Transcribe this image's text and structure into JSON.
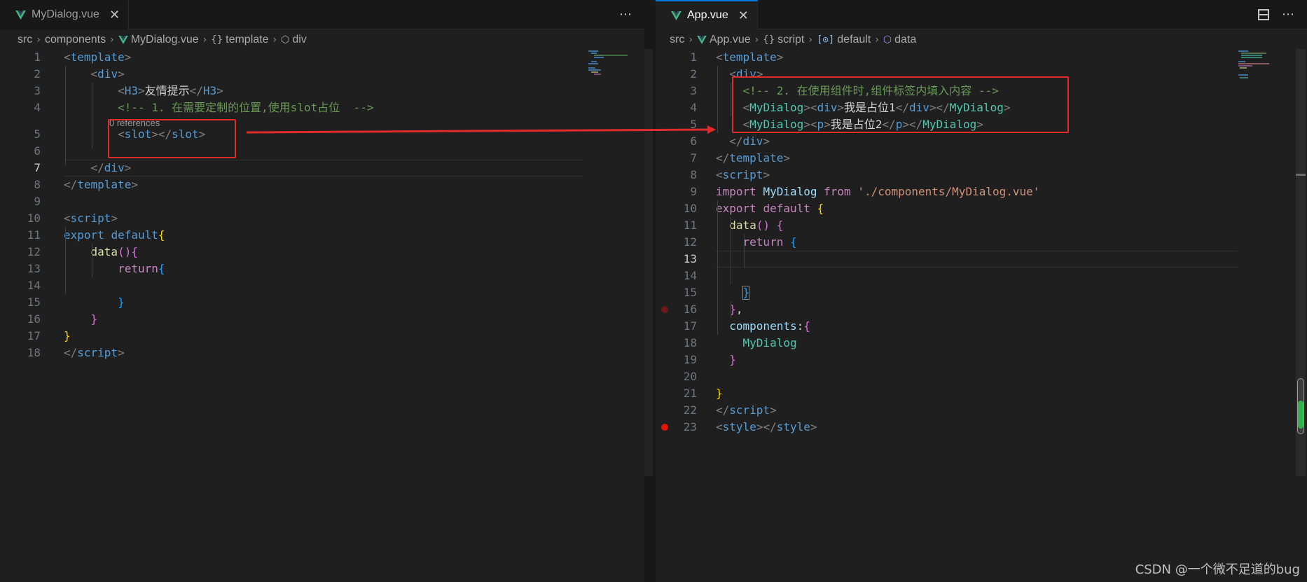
{
  "left": {
    "tab": {
      "name": "MyDialog.vue",
      "close": "✕"
    },
    "actions": {
      "more": "⋯"
    },
    "breadcrumb": [
      {
        "label": "src"
      },
      {
        "label": "components"
      },
      {
        "label": "MyDialog.vue",
        "icon": "vue-icon"
      },
      {
        "label": "template",
        "icon": "braces-icon",
        "glyph": "{}"
      },
      {
        "label": "div",
        "icon": "element-icon",
        "glyph": "⬡"
      }
    ],
    "codelens": "0 references",
    "current_line": "7",
    "lines": [
      {
        "n": "1",
        "html": "<span class='t-br'>&lt;</span><span class='t-tag'>template</span><span class='t-br'>&gt;</span>"
      },
      {
        "n": "2",
        "html": "    <span class='t-br'>&lt;</span><span class='t-tag'>div</span><span class='t-br'>&gt;</span>"
      },
      {
        "n": "3",
        "html": "        <span class='t-br'>&lt;</span><span class='t-tag'>H3</span><span class='t-br'>&gt;</span><span class='t-txt'>友情提示</span><span class='t-br'>&lt;/</span><span class='t-tag'>H3</span><span class='t-br'>&gt;</span>"
      },
      {
        "n": "4",
        "html": "        <span class='t-cmt'>&lt;!-- 1. 在需要定制的位置,使用slot占位  --&gt;</span>"
      },
      {
        "n": "5",
        "html": "        <span class='t-br'>&lt;</span><span class='t-tag'>slot</span><span class='t-br'>&gt;&lt;/</span><span class='t-tag'>slot</span><span class='t-br'>&gt;</span>"
      },
      {
        "n": "6",
        "html": ""
      },
      {
        "n": "7",
        "html": "    <span class='t-br'>&lt;/</span><span class='t-tag'>div</span><span class='t-br'>&gt;</span>"
      },
      {
        "n": "8",
        "html": "<span class='t-br'>&lt;/</span><span class='t-tag'>template</span><span class='t-br'>&gt;</span>"
      },
      {
        "n": "9",
        "html": ""
      },
      {
        "n": "10",
        "html": "<span class='t-br'>&lt;</span><span class='t-tag'>script</span><span class='t-br'>&gt;</span>"
      },
      {
        "n": "11",
        "html": "<span class='t-tag'>export</span> <span class='t-tag'>default</span><span class='b1'>{</span>"
      },
      {
        "n": "12",
        "html": "    <span class='t-fn'>data</span><span class='b2'>(){</span>"
      },
      {
        "n": "13",
        "html": "        <span class='t-kw'>return</span><span class='b3'>{</span>"
      },
      {
        "n": "14",
        "html": ""
      },
      {
        "n": "15",
        "html": "        <span class='b3'>}</span>"
      },
      {
        "n": "16",
        "html": "    <span class='b2'>}</span>"
      },
      {
        "n": "17",
        "html": "<span class='b1'>}</span>"
      },
      {
        "n": "18",
        "html": "<span class='t-br'>&lt;/</span><span class='t-tag'>script</span><span class='t-br'>&gt;</span>"
      }
    ]
  },
  "right": {
    "tab": {
      "name": "App.vue",
      "close": "✕"
    },
    "actions": {
      "split": "▭",
      "more": "⋯"
    },
    "breadcrumb": [
      {
        "label": "src"
      },
      {
        "label": "App.vue",
        "icon": "vue-icon"
      },
      {
        "label": "script",
        "icon": "braces-icon",
        "glyph": "{}"
      },
      {
        "label": "default",
        "icon": "module-icon",
        "glyph": "[⊙]"
      },
      {
        "label": "data",
        "icon": "method-icon",
        "glyph": "⬡"
      }
    ],
    "current_line": "13",
    "lines": [
      {
        "n": "1",
        "html": "<span class='t-br'>&lt;</span><span class='t-tag'>template</span><span class='t-br'>&gt;</span>"
      },
      {
        "n": "2",
        "html": "  <span class='t-br'>&lt;</span><span class='t-tag'>div</span><span class='t-br'>&gt;</span>"
      },
      {
        "n": "3",
        "html": "    <span class='t-cmt'>&lt;!-- 2. 在使用组件时,组件标签内填入内容 --&gt;</span>"
      },
      {
        "n": "4",
        "html": "    <span class='t-br'>&lt;</span><span class='t-cls'>MyDialog</span><span class='t-br'>&gt;&lt;</span><span class='t-tag'>div</span><span class='t-br'>&gt;</span><span class='t-txt'>我是占位1</span><span class='t-br'>&lt;/</span><span class='t-tag'>div</span><span class='t-br'>&gt;&lt;/</span><span class='t-cls'>MyDialog</span><span class='t-br'>&gt;</span>"
      },
      {
        "n": "5",
        "html": "    <span class='t-br'>&lt;</span><span class='t-cls'>MyDialog</span><span class='t-br'>&gt;&lt;</span><span class='t-tag'>p</span><span class='t-br'>&gt;</span><span class='t-txt'>我是占位2</span><span class='t-br'>&lt;/</span><span class='t-tag'>p</span><span class='t-br'>&gt;&lt;/</span><span class='t-cls'>MyDialog</span><span class='t-br'>&gt;</span>"
      },
      {
        "n": "6",
        "html": "  <span class='t-br'>&lt;/</span><span class='t-tag'>div</span><span class='t-br'>&gt;</span>"
      },
      {
        "n": "7",
        "html": "<span class='t-br'>&lt;/</span><span class='t-tag'>template</span><span class='t-br'>&gt;</span>"
      },
      {
        "n": "8",
        "html": "<span class='t-br'>&lt;</span><span class='t-tag'>script</span><span class='t-br'>&gt;</span>"
      },
      {
        "n": "9",
        "html": "<span class='t-kw'>import</span> <span class='t-id'>MyDialog</span> <span class='t-kw'>from</span> <span class='t-str'>'./components/MyDialog.vue'</span>"
      },
      {
        "n": "10",
        "html": "<span class='t-kw'>export</span> <span class='t-kw'>default</span> <span class='b1'>{</span>"
      },
      {
        "n": "11",
        "html": "  <span class='t-fn'>data</span><span class='b2'>()</span> <span class='b2'>{</span>"
      },
      {
        "n": "12",
        "html": "    <span class='t-kw'>return</span> <span class='b3'>{</span>"
      },
      {
        "n": "13",
        "html": ""
      },
      {
        "n": "14",
        "html": ""
      },
      {
        "n": "15",
        "html": "    <span class='b3'>}</span>"
      },
      {
        "n": "16",
        "html": "  <span class='b2'>}</span><span class='t-txt'>,</span>"
      },
      {
        "n": "17",
        "html": "  <span class='t-id'>components</span><span class='t-txt'>:</span><span class='b2'>{</span>"
      },
      {
        "n": "18",
        "html": "    <span class='t-cls'>MyDialog</span>"
      },
      {
        "n": "19",
        "html": "  <span class='b2'>}</span>"
      },
      {
        "n": "20",
        "html": ""
      },
      {
        "n": "21",
        "html": "<span class='b1'>}</span>"
      },
      {
        "n": "22",
        "html": "<span class='t-br'>&lt;/</span><span class='t-tag'>script</span><span class='t-br'>&gt;</span>"
      },
      {
        "n": "23",
        "html": "<span class='t-br'>&lt;</span><span class='t-tag'>style</span><span class='t-br'>&gt;&lt;/</span><span class='t-tag'>style</span><span class='t-br'>&gt;</span>"
      }
    ]
  },
  "colors": {
    "highlight": "#e02b2b",
    "breakpoint": "#e51400",
    "breakpoint_hint": "#6b1a1a"
  },
  "watermark": "CSDN @一个微不足道的bug"
}
